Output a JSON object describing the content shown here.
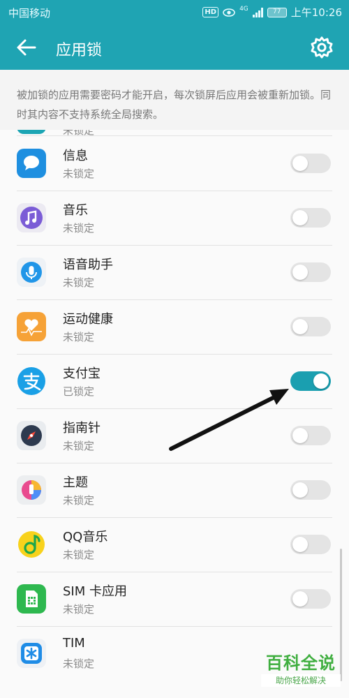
{
  "status_bar": {
    "carrier": "中国移动",
    "hd": "HD",
    "network": "4G",
    "battery": "77",
    "time": "上午10:26"
  },
  "app_bar": {
    "title": "应用锁",
    "back_icon": "back-arrow-icon",
    "settings_icon": "gear-icon"
  },
  "description": "被加锁的应用需要密码才能开启，每次锁屏后应用会被重新加锁。同时其内容不支持系统全局搜索。",
  "partial_item_status": "未锁定",
  "apps": [
    {
      "name": "信息",
      "status": "未锁定",
      "locked": false,
      "icon": "messages-icon"
    },
    {
      "name": "音乐",
      "status": "未锁定",
      "locked": false,
      "icon": "music-icon"
    },
    {
      "name": "语音助手",
      "status": "未锁定",
      "locked": false,
      "icon": "voice-assistant-icon"
    },
    {
      "name": "运动健康",
      "status": "未锁定",
      "locked": false,
      "icon": "health-icon"
    },
    {
      "name": "支付宝",
      "status": "已锁定",
      "locked": true,
      "icon": "alipay-icon"
    },
    {
      "name": "指南针",
      "status": "未锁定",
      "locked": false,
      "icon": "compass-icon"
    },
    {
      "name": "主题",
      "status": "未锁定",
      "locked": false,
      "icon": "themes-icon"
    },
    {
      "name": "QQ音乐",
      "status": "未锁定",
      "locked": false,
      "icon": "qq-music-icon"
    },
    {
      "name": "SIM 卡应用",
      "status": "未锁定",
      "locked": false,
      "icon": "sim-card-icon"
    },
    {
      "name": "TIM",
      "status": "未锁定",
      "locked": false,
      "icon": "tim-icon"
    }
  ],
  "colors": {
    "accent": "#1fa4b3",
    "toggle_on": "#1a9fb0",
    "toggle_off": "#e4e4e4"
  },
  "watermark": {
    "title": "百科全说",
    "subtitle": "助你轻松解决"
  }
}
